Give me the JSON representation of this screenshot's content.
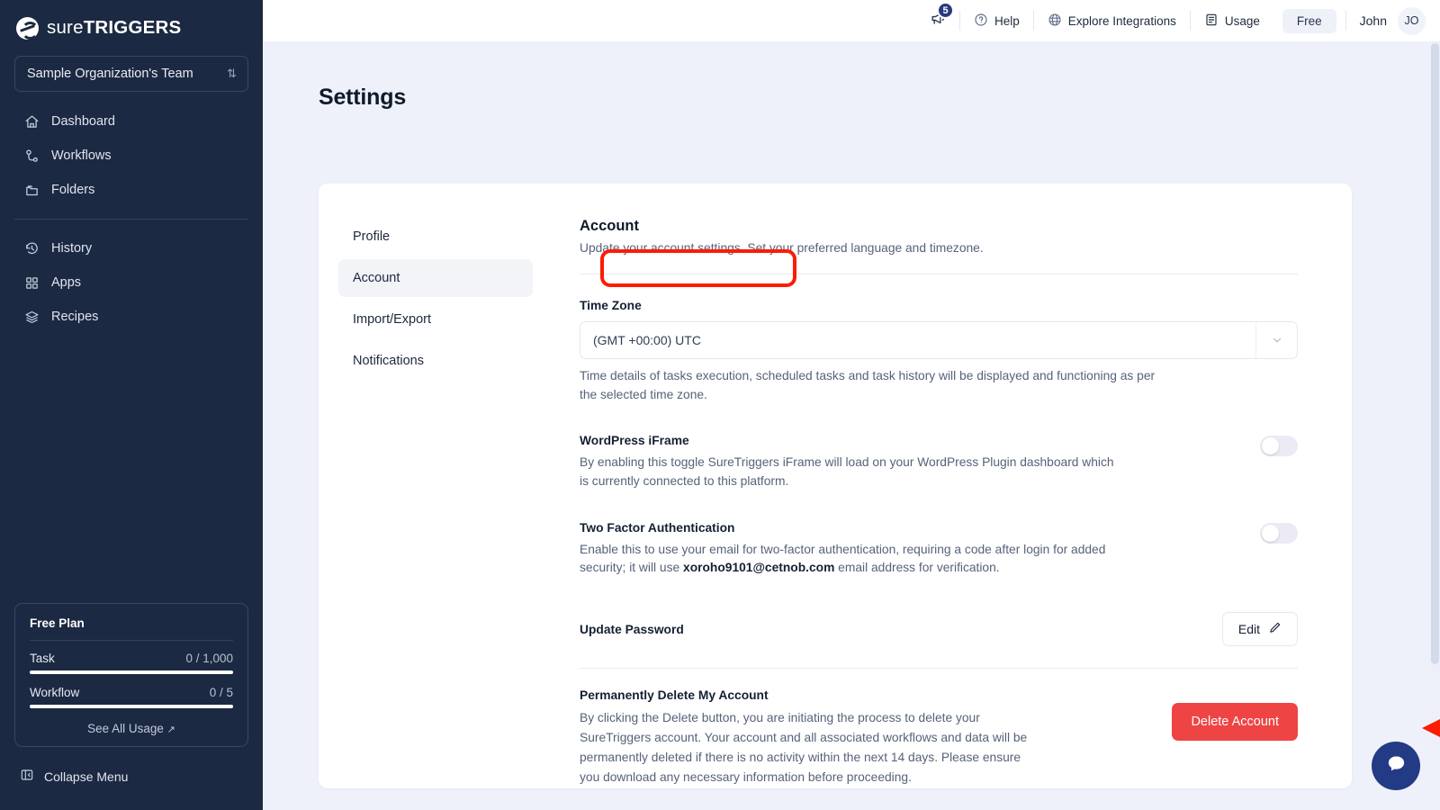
{
  "sidebar": {
    "brand": {
      "light": "sure",
      "bold": "TRIGGERS",
      "icon": "suretriggers-logo-icon"
    },
    "org": {
      "name": "Sample Organization's Team",
      "swap_icon": "swap-vertical-icon"
    },
    "nav_primary": [
      {
        "label": "Dashboard",
        "icon": "home-icon"
      },
      {
        "label": "Workflows",
        "icon": "workflow-icon"
      },
      {
        "label": "Folders",
        "icon": "folder-icon"
      }
    ],
    "nav_secondary": [
      {
        "label": "History",
        "icon": "history-icon"
      },
      {
        "label": "Apps",
        "icon": "grid-apps-icon"
      },
      {
        "label": "Recipes",
        "icon": "layers-icon"
      }
    ],
    "plan": {
      "title": "Free Plan",
      "meters": [
        {
          "label": "Task",
          "value": "0 / 1,000"
        },
        {
          "label": "Workflow",
          "value": "0 / 5"
        }
      ],
      "link": "See All Usage",
      "link_icon": "external-link-icon"
    },
    "collapse": {
      "label": "Collapse Menu",
      "icon": "collapse-panel-icon"
    }
  },
  "topbar": {
    "notifications": {
      "icon": "megaphone-icon",
      "count": "5"
    },
    "help": {
      "label": "Help",
      "icon": "question-circle-icon"
    },
    "explore": {
      "label": "Explore Integrations",
      "icon": "globe-icon"
    },
    "usage": {
      "label": "Usage",
      "icon": "document-list-icon"
    },
    "plan_badge": "Free",
    "user": {
      "name": "John",
      "initials": "JO"
    }
  },
  "page": {
    "title": "Settings"
  },
  "tabs": [
    {
      "label": "Profile",
      "active": false
    },
    {
      "label": "Account",
      "active": true
    },
    {
      "label": "Import/Export",
      "active": false
    },
    {
      "label": "Notifications",
      "active": false
    }
  ],
  "account": {
    "title": "Account",
    "subtitle": "Update your account settings. Set your preferred language and timezone.",
    "timezone": {
      "label": "Time Zone",
      "value": "(GMT +00:00) UTC",
      "caret_icon": "chevron-down-icon",
      "helper": "Time details of tasks execution, scheduled tasks and task history will be displayed and functioning as per the selected time zone."
    },
    "wp_iframe": {
      "label": "WordPress iFrame",
      "desc": "By enabling this toggle SureTriggers iFrame will load on your WordPress Plugin dashboard which is currently connected to this platform.",
      "enabled": false
    },
    "two_factor": {
      "label": "Two Factor Authentication",
      "desc_before": "Enable this to use your email for two-factor authentication, requiring a code after login for added security; it will use ",
      "email": "xoroho9101@cetnob.com",
      "desc_after": " email address for verification.",
      "enabled": false
    },
    "update_password": {
      "label": "Update Password",
      "button": "Edit",
      "button_icon": "pencil-icon"
    },
    "delete": {
      "label": "Permanently Delete My Account",
      "desc": "By clicking the Delete button, you are initiating the process to delete your SureTriggers account. Your account and all associated workflows and data will be permanently deleted if there is no activity within the next 14 days. Please ensure you download any necessary information before proceeding.",
      "button": "Delete Account"
    }
  },
  "chat": {
    "icon": "chat-bubble-icon"
  },
  "annotations": {
    "highlight_target": "Account",
    "arrow_target": "Delete Account",
    "color": "#fb1c05"
  },
  "colors": {
    "sidebar_bg": "#1c2942",
    "page_bg": "#eef1f9",
    "danger": "#ee4444",
    "brand_navy": "#233a85",
    "annotation_red": "#fb1c05"
  }
}
